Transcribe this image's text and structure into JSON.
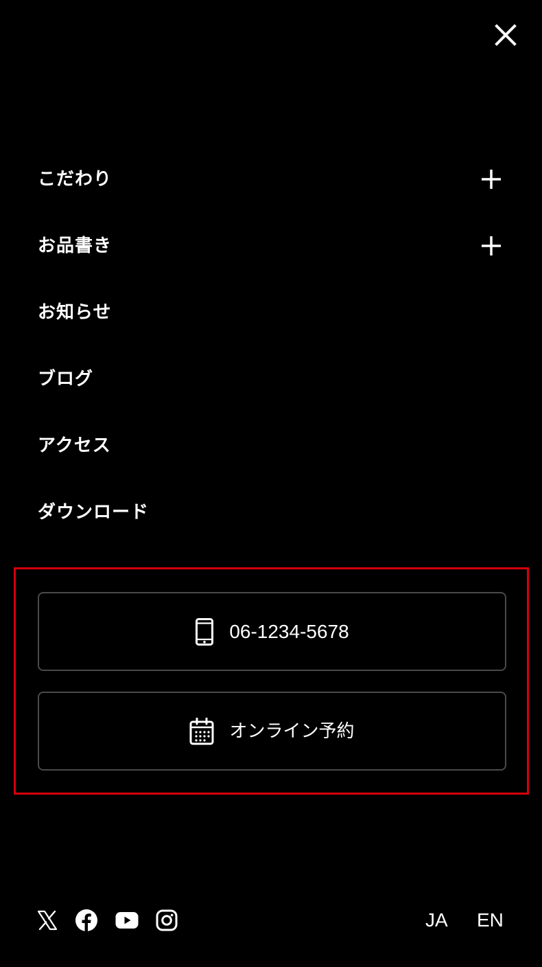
{
  "header": {
    "close_icon": "close-icon"
  },
  "menu": {
    "items": [
      {
        "label": "こだわり",
        "expandable": true
      },
      {
        "label": "お品書き",
        "expandable": true
      },
      {
        "label": "お知らせ",
        "expandable": false
      },
      {
        "label": "ブログ",
        "expandable": false
      },
      {
        "label": "アクセス",
        "expandable": false
      },
      {
        "label": "ダウンロード",
        "expandable": false
      }
    ]
  },
  "cta": {
    "highlight_color": "#d6000c",
    "phone": {
      "label": "06-1234-5678",
      "icon": "smartphone-icon"
    },
    "reserve": {
      "label": "オンライン予約",
      "icon": "calendar-icon"
    }
  },
  "social": {
    "icons": [
      "x-icon",
      "facebook-icon",
      "youtube-icon",
      "instagram-icon"
    ]
  },
  "languages": {
    "ja": "JA",
    "en": "EN"
  }
}
